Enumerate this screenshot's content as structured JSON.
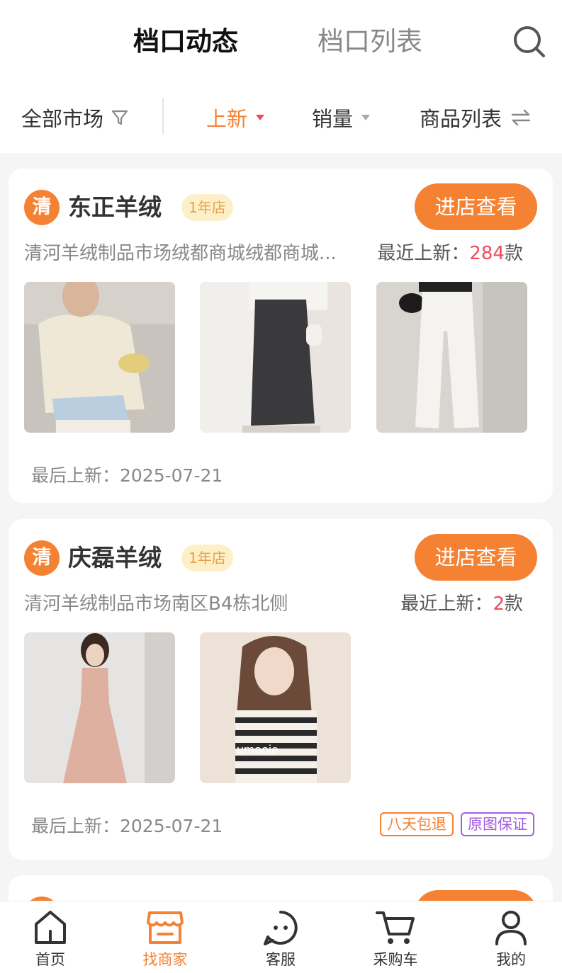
{
  "header": {
    "tabs": [
      {
        "label": "档口动态",
        "active": true
      },
      {
        "label": "档口列表",
        "active": false
      }
    ],
    "search_icon": "search-icon"
  },
  "filters": {
    "market": "全部市场",
    "new": "上新",
    "sales": "销量",
    "list": "商品列表",
    "accent_color": "#f58233"
  },
  "shops": [
    {
      "badge": "清",
      "name": "东正羊绒",
      "years": "1年店",
      "enter_label": "进店查看",
      "address": "清河羊绒制品市场绒都商城绒都商城...",
      "recent_prefix": "最近上新：",
      "recent_count": "284",
      "recent_suffix": "款",
      "last_new": "最后上新：2025-07-21",
      "products": [
        "knit-blouse-denim-skirt",
        "black-midi-skirt",
        "white-wide-leg-pants"
      ],
      "tags": []
    },
    {
      "badge": "清",
      "name": "庆磊羊绒",
      "years": "1年店",
      "enter_label": "进店查看",
      "address": "清河羊绒制品市场南区B4栋北侧",
      "recent_prefix": "最近上新：",
      "recent_count": "2",
      "recent_suffix": "款",
      "last_new": "最后上新：2025-07-21",
      "products": [
        "pink-knit-dress",
        "striped-knit-top"
      ],
      "tags": [
        "八天包退",
        "原图保证"
      ],
      "watermark": "umooie"
    }
  ],
  "bottom_nav": [
    {
      "label": "首页",
      "icon": "home-icon",
      "active": false
    },
    {
      "label": "找商家",
      "icon": "store-icon",
      "active": true
    },
    {
      "label": "客服",
      "icon": "chat-icon",
      "active": false
    },
    {
      "label": "采购车",
      "icon": "cart-icon",
      "active": false
    },
    {
      "label": "我的",
      "icon": "user-icon",
      "active": false
    }
  ]
}
